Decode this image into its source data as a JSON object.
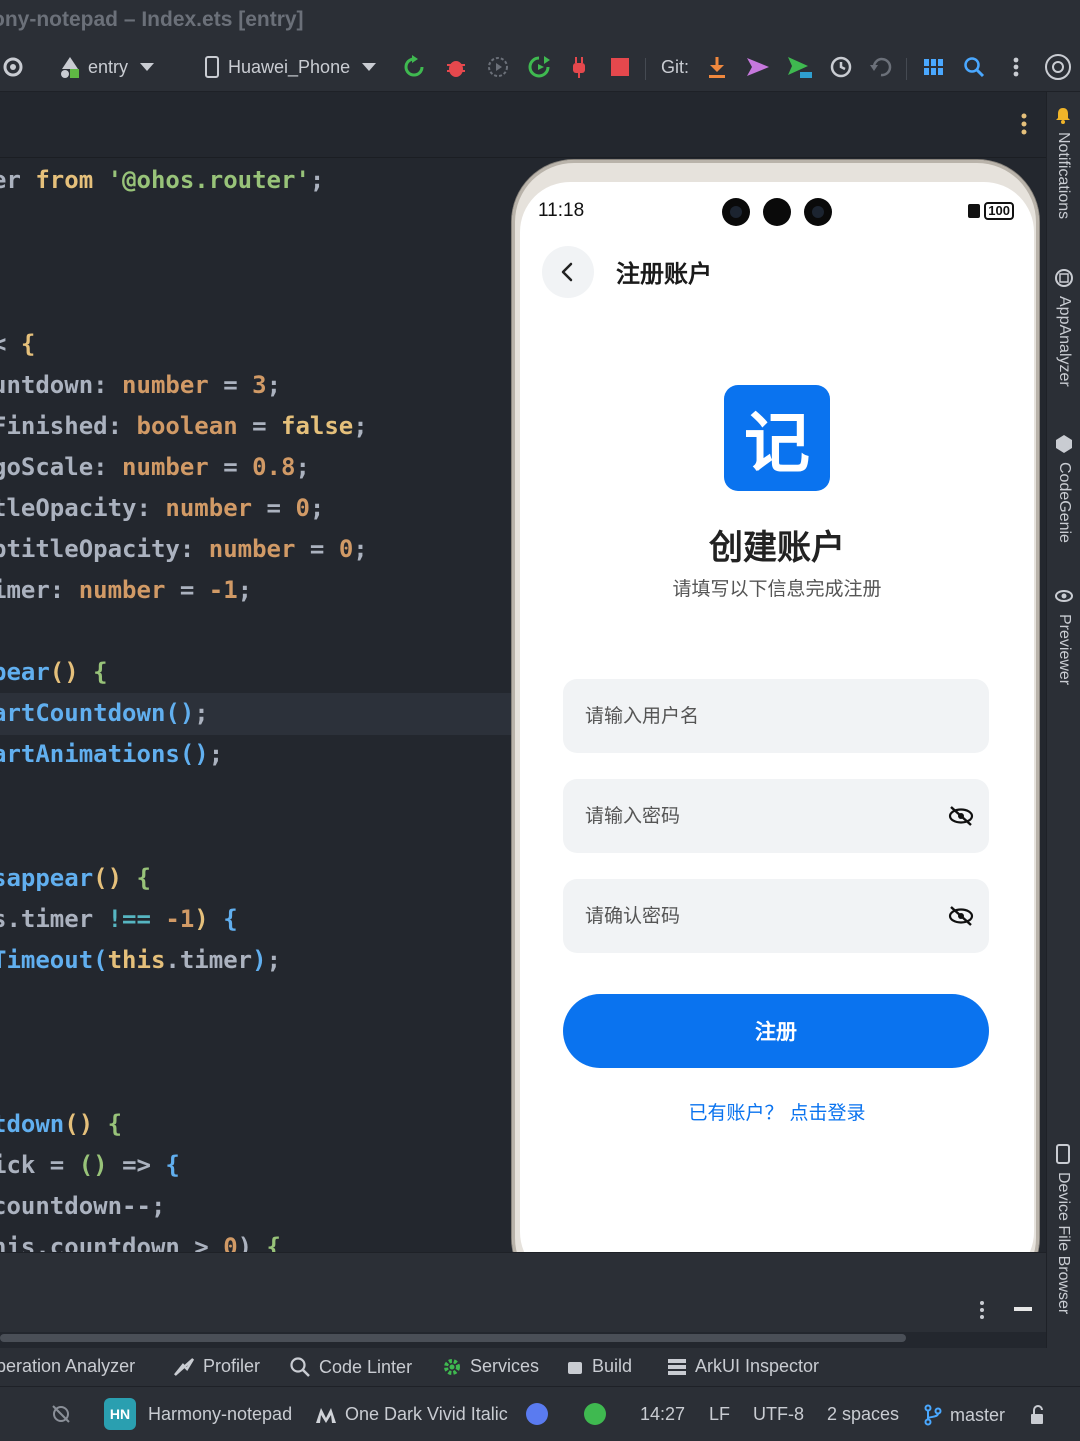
{
  "window": {
    "title": "ony-notepad – Index.ets [entry]"
  },
  "toolbar": {
    "module": "entry",
    "device": "Huawei_Phone",
    "git_label": "Git:"
  },
  "code_lines": [
    {
      "segments": [
        [
          "pn",
          "er "
        ],
        [
          "kw2",
          "from "
        ],
        [
          "str",
          "'@ohos.router'"
        ],
        [
          "pn",
          ";"
        ]
      ]
    },
    {
      "segments": [
        [
          "pn",
          "< "
        ],
        [
          "brk1",
          "{"
        ]
      ]
    },
    {
      "segments": [
        [
          "pn",
          "untdown: "
        ],
        [
          "num",
          "number "
        ],
        [
          "pn",
          "= "
        ],
        [
          "num",
          "3"
        ],
        [
          "pn",
          ";"
        ]
      ]
    },
    {
      "segments": [
        [
          "pn",
          "Finished: "
        ],
        [
          "num",
          "boolean "
        ],
        [
          "pn",
          "= "
        ],
        [
          "kw2",
          "false"
        ],
        [
          "pn",
          ";"
        ]
      ]
    },
    {
      "segments": [
        [
          "pn",
          "goScale: "
        ],
        [
          "num",
          "number "
        ],
        [
          "pn",
          "= "
        ],
        [
          "num",
          "0.8"
        ],
        [
          "pn",
          ";"
        ]
      ]
    },
    {
      "segments": [
        [
          "pn",
          "tleOpacity: "
        ],
        [
          "num",
          "number "
        ],
        [
          "pn",
          "= "
        ],
        [
          "num",
          "0"
        ],
        [
          "pn",
          ";"
        ]
      ]
    },
    {
      "segments": [
        [
          "pn",
          "btitleOpacity: "
        ],
        [
          "num",
          "number "
        ],
        [
          "pn",
          "= "
        ],
        [
          "num",
          "0"
        ],
        [
          "pn",
          ";"
        ]
      ]
    },
    {
      "segments": [
        [
          "pn",
          "imer: "
        ],
        [
          "num",
          "number "
        ],
        [
          "pn",
          "= "
        ],
        [
          "num",
          "-1"
        ],
        [
          "pn",
          ";"
        ]
      ]
    },
    {
      "segments": [
        [
          "fn",
          "pear"
        ],
        [
          "brk1",
          "() "
        ],
        [
          "str",
          "{"
        ]
      ]
    },
    {
      "segments": [
        [
          "fn",
          "artCountdown"
        ],
        [
          "brk3",
          "()"
        ],
        [
          "pn",
          ";"
        ]
      ]
    },
    {
      "segments": [
        [
          "fn",
          "artAnimations"
        ],
        [
          "brk3",
          "()"
        ],
        [
          "pn",
          ";"
        ]
      ]
    },
    {
      "segments": [
        [
          "fn",
          "sappear"
        ],
        [
          "brk1",
          "() "
        ],
        [
          "str",
          "{"
        ]
      ]
    },
    {
      "segments": [
        [
          "pn",
          "s.timer "
        ],
        [
          "brc",
          "!== "
        ],
        [
          "num",
          "-1"
        ],
        [
          "brk1",
          ") "
        ],
        [
          "brk3",
          "{"
        ]
      ]
    },
    {
      "segments": [
        [
          "fn",
          "Timeout"
        ],
        [
          "brk3",
          "("
        ],
        [
          "kw2",
          "this"
        ],
        [
          "pn",
          ".timer"
        ],
        [
          "brk3",
          ")"
        ],
        [
          "pn",
          ";"
        ]
      ]
    },
    {
      "segments": [
        [
          "fn",
          "tdown"
        ],
        [
          "brk1",
          "() "
        ],
        [
          "str",
          "{"
        ]
      ]
    },
    {
      "segments": [
        [
          "pn",
          "ick "
        ],
        [
          "pn",
          "= "
        ],
        [
          "str",
          "() "
        ],
        [
          "pn",
          "=> "
        ],
        [
          "brk3",
          "{"
        ]
      ]
    },
    {
      "segments": [
        [
          "pn",
          "countdown--;"
        ]
      ]
    },
    {
      "segments": [
        [
          "pn",
          "nis.countdown > "
        ],
        [
          "num",
          "0"
        ],
        [
          "pn",
          ") "
        ],
        [
          "str",
          "{"
        ]
      ]
    }
  ],
  "side_tabs": {
    "notifications": "Notifications",
    "app_analyzer": "AppAnalyzer",
    "codegenie": "CodeGenie",
    "previewer": "Previewer",
    "device_file_browser": "Device File Browser"
  },
  "phone": {
    "time": "11:18",
    "battery": "100",
    "nav_title": "注册账户",
    "logo_char": "记",
    "heading": "创建账户",
    "subheading": "请填写以下信息完成注册",
    "username_placeholder": "请输入用户名",
    "password_placeholder": "请输入密码",
    "confirm_placeholder": "请确认密码",
    "register_button": "注册",
    "login_link": "已有账户？ 点击登录"
  },
  "tool_tabs": {
    "operation_analyzer": "peration Analyzer",
    "profiler": "Profiler",
    "code_linter": "Code Linter",
    "services": "Services",
    "build": "Build",
    "arkui_inspector": "ArkUI Inspector"
  },
  "status": {
    "project_badge": "HN",
    "project": "Harmony-notepad",
    "theme": "One Dark Vivid Italic",
    "position": "14:27",
    "line_sep": "LF",
    "encoding": "UTF-8",
    "indent": "2 spaces",
    "branch": "master"
  },
  "colors": {
    "accent_blue": "#0a73ef",
    "editor_bg": "#23272e",
    "panel_bg": "#2b2f36"
  }
}
